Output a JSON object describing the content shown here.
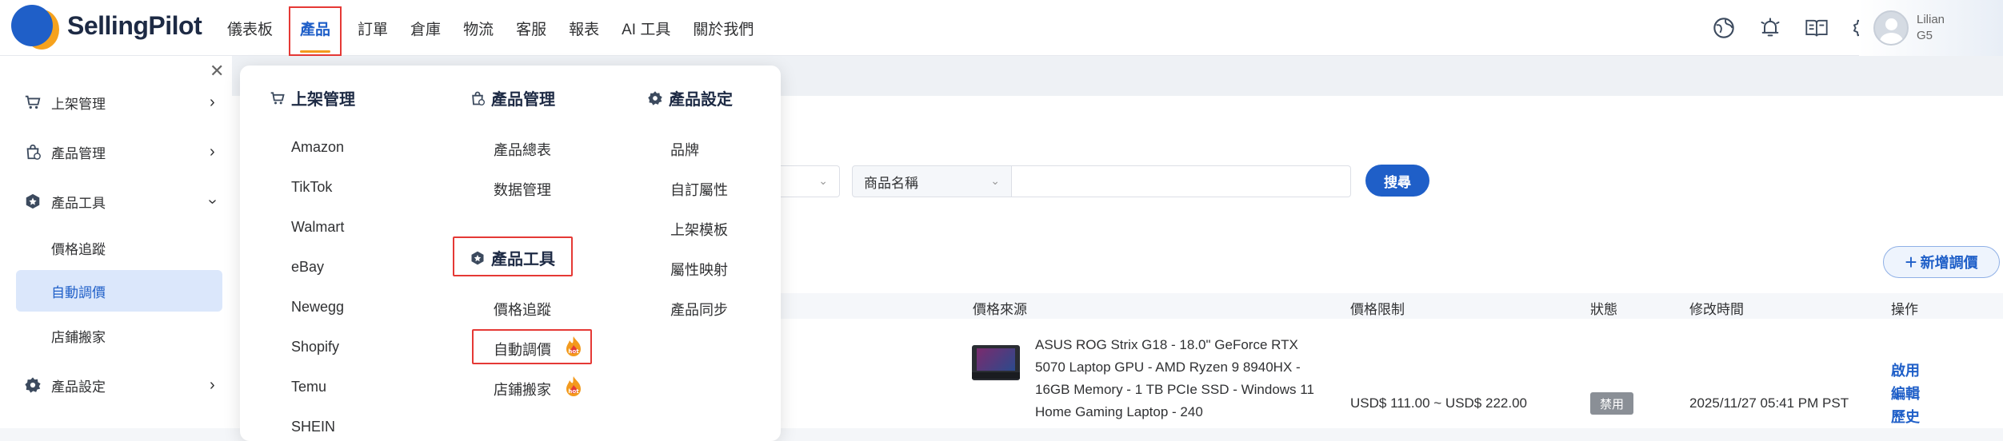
{
  "brand": {
    "name_part1": "Selling",
    "name_part2": "Pilot"
  },
  "nav": {
    "items": [
      "儀表板",
      "產品",
      "訂單",
      "倉庫",
      "物流",
      "客服",
      "報表",
      "AI 工具",
      "關於我們"
    ],
    "active": "產品"
  },
  "user": {
    "line1": "Lilian",
    "line2": "G5"
  },
  "top_icons": [
    "globe-icon",
    "bell-icon",
    "book-icon",
    "gear-icon"
  ],
  "sidebar": {
    "items": [
      {
        "label": "上架管理",
        "icon": "cart-icon",
        "expanded": false
      },
      {
        "label": "產品管理",
        "icon": "bag-icon",
        "expanded": false
      },
      {
        "label": "產品工具",
        "icon": "star-icon",
        "expanded": true
      },
      {
        "label": "產品設定",
        "icon": "gear-icon",
        "expanded": false
      }
    ],
    "subitems": [
      "價格追蹤",
      "自動調價",
      "店鋪搬家"
    ],
    "active_sub": "自動調價"
  },
  "mega_menu": {
    "col1": {
      "title": "上架管理",
      "items": [
        "Amazon",
        "TikTok",
        "Walmart",
        "eBay",
        "Newegg",
        "Shopify",
        "Temu",
        "SHEIN"
      ]
    },
    "col2": {
      "title": "產品管理",
      "items": [
        "產品總表",
        "数据管理"
      ],
      "tools_title": "產品工具",
      "tools_items": [
        "價格追蹤",
        "自動調價",
        "店鋪搬家"
      ],
      "hot_items": [
        "自動調價",
        "店鋪搬家"
      ]
    },
    "col3": {
      "title": "產品設定",
      "items": [
        "品牌",
        "自訂屬性",
        "上架模板",
        "屬性映射",
        "產品同步"
      ]
    }
  },
  "filters": {
    "field_select": "商品名稱",
    "search_button": "搜尋",
    "add_button": "新增調價"
  },
  "table": {
    "headers": [
      "價格來源",
      "價格限制",
      "狀態",
      "修改時間",
      "操作"
    ],
    "rows": [
      {
        "title": "ASUS ROG Strix G18 - 18.0\" GeForce RTX 5070 Laptop GPU - AMD Ryzen 9 8940HX - 16GB Memory - 1 TB PCIe SSD - Windows 11 Home Gaming Laptop - 240",
        "price_limit": "USD$ 111.00 ~ USD$ 222.00",
        "status": "禁用",
        "modified": "2025/11/27 05:41 PM PST",
        "actions": [
          "啟用",
          "編輯",
          "歷史"
        ]
      }
    ]
  },
  "colors": {
    "primary": "#1f5fc8",
    "accent": "#f39a1d",
    "highlight_box": "#e53935",
    "active_bg": "#dbe7fb"
  }
}
